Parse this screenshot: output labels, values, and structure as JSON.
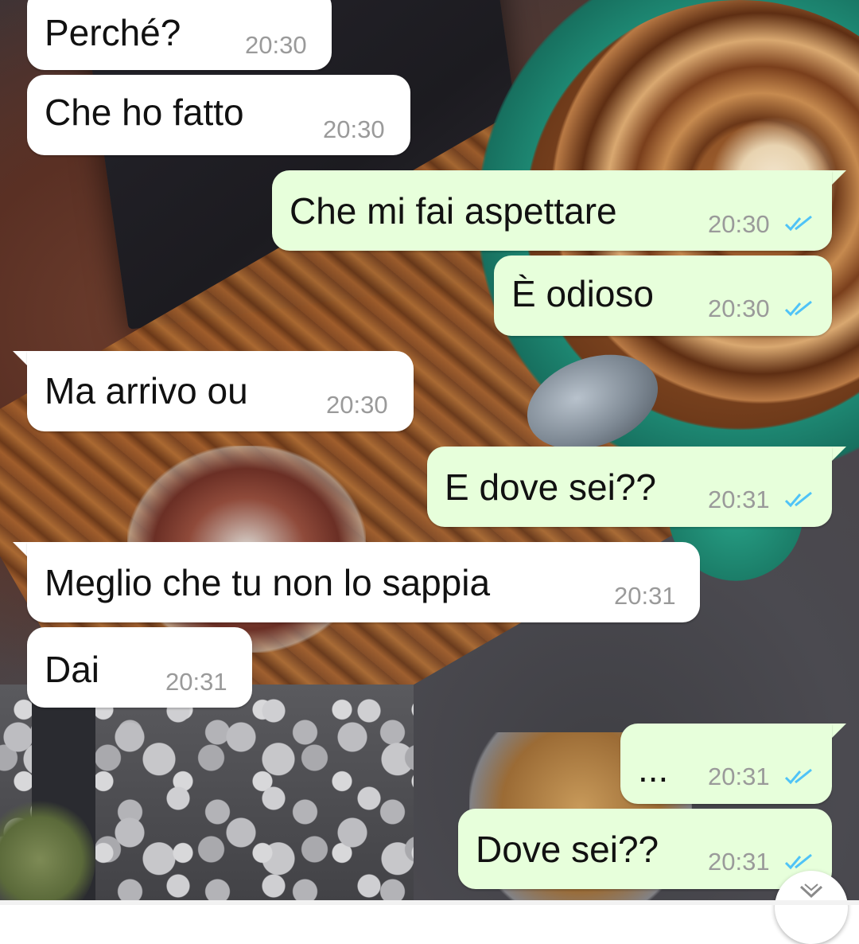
{
  "chat": {
    "messages": [
      {
        "direction": "incoming",
        "text": "Perché?",
        "time": "20:30"
      },
      {
        "direction": "incoming",
        "text": "Che ho fatto",
        "time": "20:30"
      },
      {
        "direction": "outgoing",
        "text": "Che mi fai aspettare",
        "time": "20:30",
        "status": "read"
      },
      {
        "direction": "outgoing",
        "text": "È odioso",
        "time": "20:30",
        "status": "read"
      },
      {
        "direction": "incoming",
        "text": "Ma arrivo ou",
        "time": "20:30"
      },
      {
        "direction": "outgoing",
        "text": "E dove sei??",
        "time": "20:31",
        "status": "read"
      },
      {
        "direction": "incoming",
        "text": "Meglio che tu non lo sappia",
        "time": "20:31"
      },
      {
        "direction": "incoming",
        "text": "Dai",
        "time": "20:31"
      },
      {
        "direction": "outgoing",
        "text": "...",
        "time": "20:31",
        "status": "read"
      },
      {
        "direction": "outgoing",
        "text": "Dove sei??",
        "time": "20:31",
        "status": "read"
      }
    ]
  },
  "icons": {
    "read_receipt": "double-check-icon",
    "scroll_down": "chevron-down-icon"
  },
  "colors": {
    "incoming_bubble": "#ffffff",
    "outgoing_bubble": "#e7ffdb",
    "read_tick": "#4fc3f7",
    "timestamp": "#9a9a9a"
  }
}
